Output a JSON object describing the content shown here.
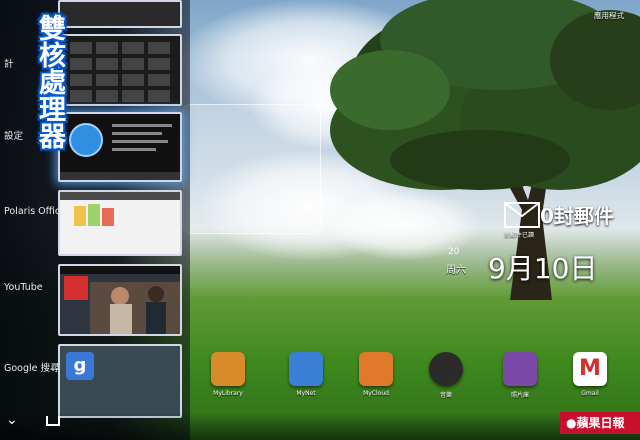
{
  "promo_text": "雙核處理器",
  "recent_apps": [
    {
      "label": "計",
      "thumb": "calculator"
    },
    {
      "label": "設定",
      "thumb": "settings"
    },
    {
      "label": "Polaris Offic",
      "thumb": "polaris-office"
    },
    {
      "label": "YouTube",
      "thumb": "youtube"
    },
    {
      "label": "Google 搜尋",
      "thumb": "google-search"
    }
  ],
  "mail_widget": {
    "count_text": "0封郵件",
    "caption": "新郵件已讀"
  },
  "clock_widget": {
    "weekday": "周六",
    "date": "9月10日",
    "year_fragment": "20"
  },
  "top_right_label": "應用程式",
  "dock": [
    {
      "label": "MyLibrary",
      "icon": "library-icon",
      "color": "#d98a2a"
    },
    {
      "label": "MyNet",
      "icon": "mynet-icon",
      "color": "#3a7fd6"
    },
    {
      "label": "MyCloud",
      "icon": "cloud-icon",
      "color": "#e07a2a"
    },
    {
      "label": "音樂",
      "icon": "headphones-icon",
      "color": "#2b2b2b"
    },
    {
      "label": "照片庫",
      "icon": "gallery-icon",
      "color": "#7a4aa8"
    },
    {
      "label": "Gmail",
      "icon": "gmail-icon",
      "color": "#ffffff"
    }
  ],
  "watermark": "蘋果日報"
}
